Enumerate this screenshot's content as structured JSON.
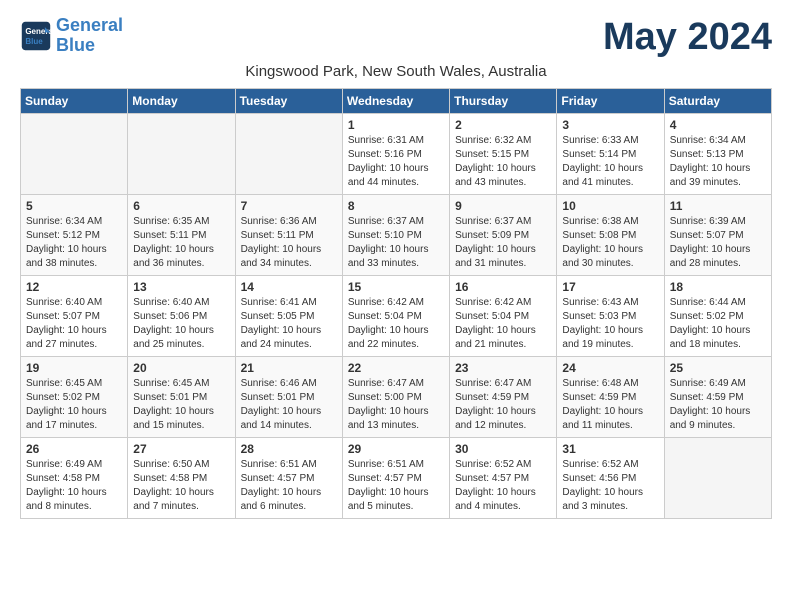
{
  "logo": {
    "line1": "General",
    "line2": "Blue"
  },
  "title": "May 2024",
  "subtitle": "Kingswood Park, New South Wales, Australia",
  "headers": [
    "Sunday",
    "Monday",
    "Tuesday",
    "Wednesday",
    "Thursday",
    "Friday",
    "Saturday"
  ],
  "weeks": [
    [
      {
        "num": "",
        "info": ""
      },
      {
        "num": "",
        "info": ""
      },
      {
        "num": "",
        "info": ""
      },
      {
        "num": "1",
        "info": "Sunrise: 6:31 AM\nSunset: 5:16 PM\nDaylight: 10 hours\nand 44 minutes."
      },
      {
        "num": "2",
        "info": "Sunrise: 6:32 AM\nSunset: 5:15 PM\nDaylight: 10 hours\nand 43 minutes."
      },
      {
        "num": "3",
        "info": "Sunrise: 6:33 AM\nSunset: 5:14 PM\nDaylight: 10 hours\nand 41 minutes."
      },
      {
        "num": "4",
        "info": "Sunrise: 6:34 AM\nSunset: 5:13 PM\nDaylight: 10 hours\nand 39 minutes."
      }
    ],
    [
      {
        "num": "5",
        "info": "Sunrise: 6:34 AM\nSunset: 5:12 PM\nDaylight: 10 hours\nand 38 minutes."
      },
      {
        "num": "6",
        "info": "Sunrise: 6:35 AM\nSunset: 5:11 PM\nDaylight: 10 hours\nand 36 minutes."
      },
      {
        "num": "7",
        "info": "Sunrise: 6:36 AM\nSunset: 5:11 PM\nDaylight: 10 hours\nand 34 minutes."
      },
      {
        "num": "8",
        "info": "Sunrise: 6:37 AM\nSunset: 5:10 PM\nDaylight: 10 hours\nand 33 minutes."
      },
      {
        "num": "9",
        "info": "Sunrise: 6:37 AM\nSunset: 5:09 PM\nDaylight: 10 hours\nand 31 minutes."
      },
      {
        "num": "10",
        "info": "Sunrise: 6:38 AM\nSunset: 5:08 PM\nDaylight: 10 hours\nand 30 minutes."
      },
      {
        "num": "11",
        "info": "Sunrise: 6:39 AM\nSunset: 5:07 PM\nDaylight: 10 hours\nand 28 minutes."
      }
    ],
    [
      {
        "num": "12",
        "info": "Sunrise: 6:40 AM\nSunset: 5:07 PM\nDaylight: 10 hours\nand 27 minutes."
      },
      {
        "num": "13",
        "info": "Sunrise: 6:40 AM\nSunset: 5:06 PM\nDaylight: 10 hours\nand 25 minutes."
      },
      {
        "num": "14",
        "info": "Sunrise: 6:41 AM\nSunset: 5:05 PM\nDaylight: 10 hours\nand 24 minutes."
      },
      {
        "num": "15",
        "info": "Sunrise: 6:42 AM\nSunset: 5:04 PM\nDaylight: 10 hours\nand 22 minutes."
      },
      {
        "num": "16",
        "info": "Sunrise: 6:42 AM\nSunset: 5:04 PM\nDaylight: 10 hours\nand 21 minutes."
      },
      {
        "num": "17",
        "info": "Sunrise: 6:43 AM\nSunset: 5:03 PM\nDaylight: 10 hours\nand 19 minutes."
      },
      {
        "num": "18",
        "info": "Sunrise: 6:44 AM\nSunset: 5:02 PM\nDaylight: 10 hours\nand 18 minutes."
      }
    ],
    [
      {
        "num": "19",
        "info": "Sunrise: 6:45 AM\nSunset: 5:02 PM\nDaylight: 10 hours\nand 17 minutes."
      },
      {
        "num": "20",
        "info": "Sunrise: 6:45 AM\nSunset: 5:01 PM\nDaylight: 10 hours\nand 15 minutes."
      },
      {
        "num": "21",
        "info": "Sunrise: 6:46 AM\nSunset: 5:01 PM\nDaylight: 10 hours\nand 14 minutes."
      },
      {
        "num": "22",
        "info": "Sunrise: 6:47 AM\nSunset: 5:00 PM\nDaylight: 10 hours\nand 13 minutes."
      },
      {
        "num": "23",
        "info": "Sunrise: 6:47 AM\nSunset: 4:59 PM\nDaylight: 10 hours\nand 12 minutes."
      },
      {
        "num": "24",
        "info": "Sunrise: 6:48 AM\nSunset: 4:59 PM\nDaylight: 10 hours\nand 11 minutes."
      },
      {
        "num": "25",
        "info": "Sunrise: 6:49 AM\nSunset: 4:59 PM\nDaylight: 10 hours\nand 9 minutes."
      }
    ],
    [
      {
        "num": "26",
        "info": "Sunrise: 6:49 AM\nSunset: 4:58 PM\nDaylight: 10 hours\nand 8 minutes."
      },
      {
        "num": "27",
        "info": "Sunrise: 6:50 AM\nSunset: 4:58 PM\nDaylight: 10 hours\nand 7 minutes."
      },
      {
        "num": "28",
        "info": "Sunrise: 6:51 AM\nSunset: 4:57 PM\nDaylight: 10 hours\nand 6 minutes."
      },
      {
        "num": "29",
        "info": "Sunrise: 6:51 AM\nSunset: 4:57 PM\nDaylight: 10 hours\nand 5 minutes."
      },
      {
        "num": "30",
        "info": "Sunrise: 6:52 AM\nSunset: 4:57 PM\nDaylight: 10 hours\nand 4 minutes."
      },
      {
        "num": "31",
        "info": "Sunrise: 6:52 AM\nSunset: 4:56 PM\nDaylight: 10 hours\nand 3 minutes."
      },
      {
        "num": "",
        "info": ""
      }
    ]
  ]
}
